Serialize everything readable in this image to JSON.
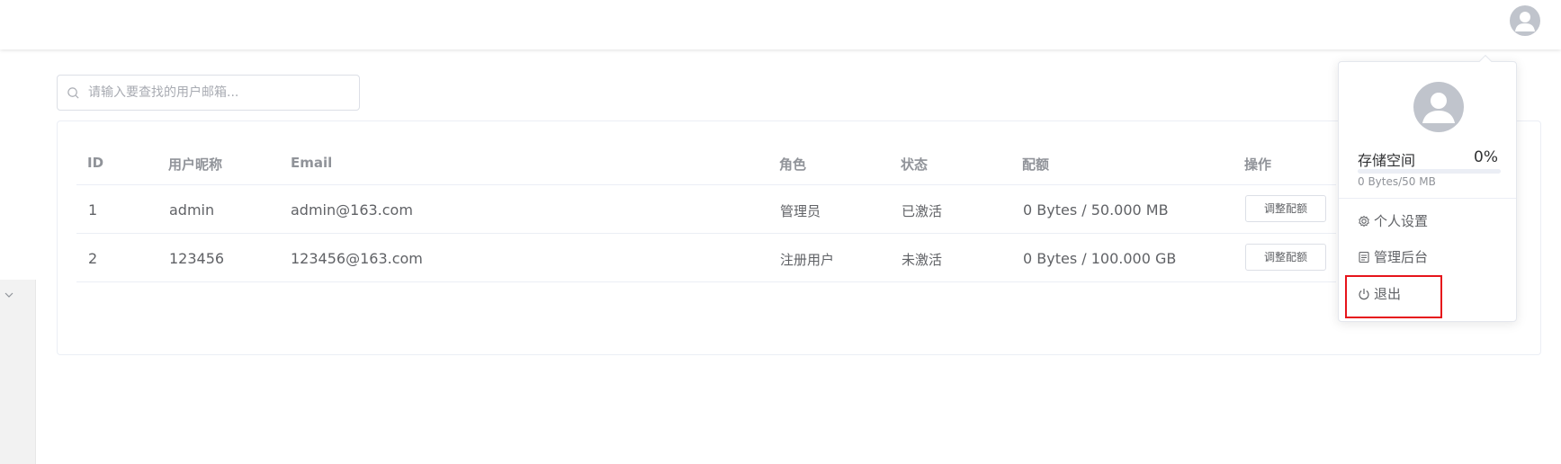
{
  "search": {
    "placeholder": "请输入要查找的用户邮箱..."
  },
  "table": {
    "headers": [
      "ID",
      "用户昵称",
      "Email",
      "角色",
      "状态",
      "配额",
      "操作"
    ],
    "rows": [
      {
        "id": "1",
        "nickname": "admin",
        "email": "admin@163.com",
        "role": "管理员",
        "status": "已激活",
        "quota": "0 Bytes / 50.000 MB",
        "action": "调整配额"
      },
      {
        "id": "2",
        "nickname": "123456",
        "email": "123456@163.com",
        "role": "注册用户",
        "status": "未激活",
        "quota": "0 Bytes / 100.000 GB",
        "action": "调整配额"
      }
    ]
  },
  "user_menu": {
    "storage_title": "存储空间",
    "storage_percent": "0%",
    "storage_fraction": 0,
    "storage_detail": "0 Bytes/50 MB",
    "items": [
      {
        "label": "个人设置",
        "icon": "gear-icon"
      },
      {
        "label": "管理后台",
        "icon": "admin-panel-icon"
      },
      {
        "label": "退出",
        "icon": "power-icon"
      }
    ],
    "highlight_color": "#e6141b"
  },
  "colors": {
    "accent": "#409eff",
    "avatar_bg": "#c0c4cc"
  }
}
